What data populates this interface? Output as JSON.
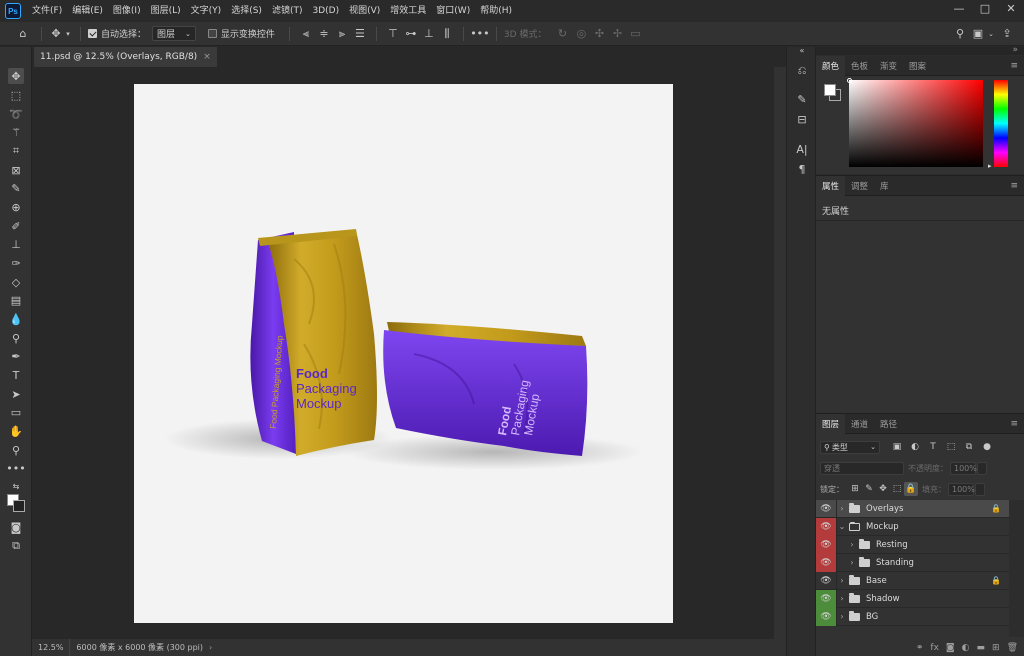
{
  "app": {
    "logo": "Ps"
  },
  "menubar": {
    "items": [
      "文件(F)",
      "编辑(E)",
      "图像(I)",
      "图层(L)",
      "文字(Y)",
      "选择(S)",
      "滤镜(T)",
      "3D(D)",
      "视图(V)",
      "增效工具",
      "窗口(W)",
      "帮助(H)"
    ]
  },
  "window_controls": {
    "minimize": "—",
    "maximize": "□",
    "close": "✕"
  },
  "optionsbar": {
    "auto_select_label": "自动选择：",
    "auto_select_value": "图层",
    "transform_label": "显示变换控件",
    "mode_3d_label": "3D 模式："
  },
  "document": {
    "tab_title": "11.psd @ 12.5% (Overlays, RGB/8)",
    "close_glyph": "×"
  },
  "statusbar": {
    "zoom": "12.5%",
    "info": "6000 像素 x 6000 像素 (300 ppi)",
    "arrow": "›"
  },
  "canvas_content": {
    "standing_bag": {
      "line1": "Food",
      "line2": "Packaging",
      "line3": "Mockup",
      "side_text": "Food Packaging Mockup"
    },
    "lying_bag": {
      "line1": "Food",
      "line2": "Packaging",
      "line3": "Mockup"
    },
    "colors": {
      "gold": "#c9a21a",
      "purple": "#6b2fd8",
      "canvas_bg": "#f3f3f3"
    }
  },
  "color_panel": {
    "tabs": [
      "颜色",
      "色板",
      "渐变",
      "图案"
    ],
    "foreground": "#ffffff",
    "background": "#323232"
  },
  "properties_panel": {
    "tabs": [
      "属性",
      "调整",
      "库"
    ],
    "empty_text": "无属性"
  },
  "layers_panel": {
    "tabs": [
      "图层",
      "通道",
      "路径"
    ],
    "filter_label": "类型",
    "blend_mode": "穿透",
    "opacity_label": "不透明度：",
    "opacity_value": "100%",
    "lock_label": "锁定：",
    "fill_label": "填充：",
    "fill_value": "100%",
    "layers": [
      {
        "name": "Overlays",
        "indent": 0,
        "eye_color": "none",
        "expanded": false,
        "locked": true,
        "selected": true
      },
      {
        "name": "Mockup",
        "indent": 0,
        "eye_color": "red",
        "expanded": true,
        "locked": false,
        "selected": false
      },
      {
        "name": "Resting",
        "indent": 1,
        "eye_color": "red",
        "expanded": false,
        "locked": false,
        "selected": false
      },
      {
        "name": "Standing",
        "indent": 1,
        "eye_color": "red",
        "expanded": false,
        "locked": false,
        "selected": false
      },
      {
        "name": "Base",
        "indent": 0,
        "eye_color": "none",
        "expanded": false,
        "locked": true,
        "selected": false
      },
      {
        "name": "Shadow",
        "indent": 0,
        "eye_color": "green",
        "expanded": false,
        "locked": false,
        "selected": false
      },
      {
        "name": "BG",
        "indent": 0,
        "eye_color": "green",
        "expanded": false,
        "locked": false,
        "selected": false
      }
    ]
  }
}
